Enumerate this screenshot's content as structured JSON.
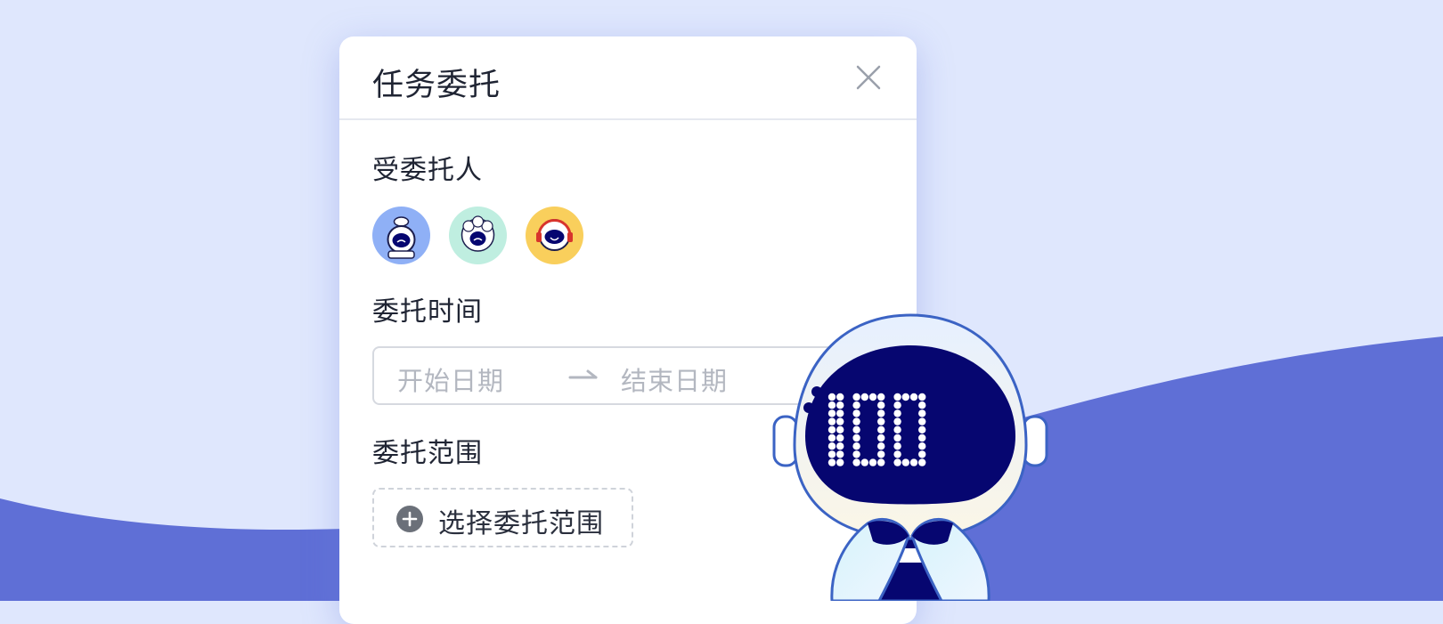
{
  "dialog": {
    "title": "任务委托",
    "close_icon": "close-icon"
  },
  "delegates": {
    "label": "受委托人",
    "avatars": [
      {
        "name": "avatar-chef",
        "bg": "#8fb0f6"
      },
      {
        "name": "avatar-wool",
        "bg": "#bfeee0"
      },
      {
        "name": "avatar-headphones",
        "bg": "#f9cf5c"
      }
    ]
  },
  "time": {
    "label": "委托时间",
    "start_placeholder": "开始日期",
    "end_placeholder": "结束日期",
    "arrow_icon": "arrow-right-icon"
  },
  "scope": {
    "label": "委托范围",
    "button_label": "选择委托范围",
    "icon": "plus-circle-icon"
  },
  "colors": {
    "background": "#dfe7fd",
    "wave": "#5f6fd6",
    "robot_visor": "#060670",
    "text": "#1f2433",
    "placeholder": "#b3b7c0"
  }
}
